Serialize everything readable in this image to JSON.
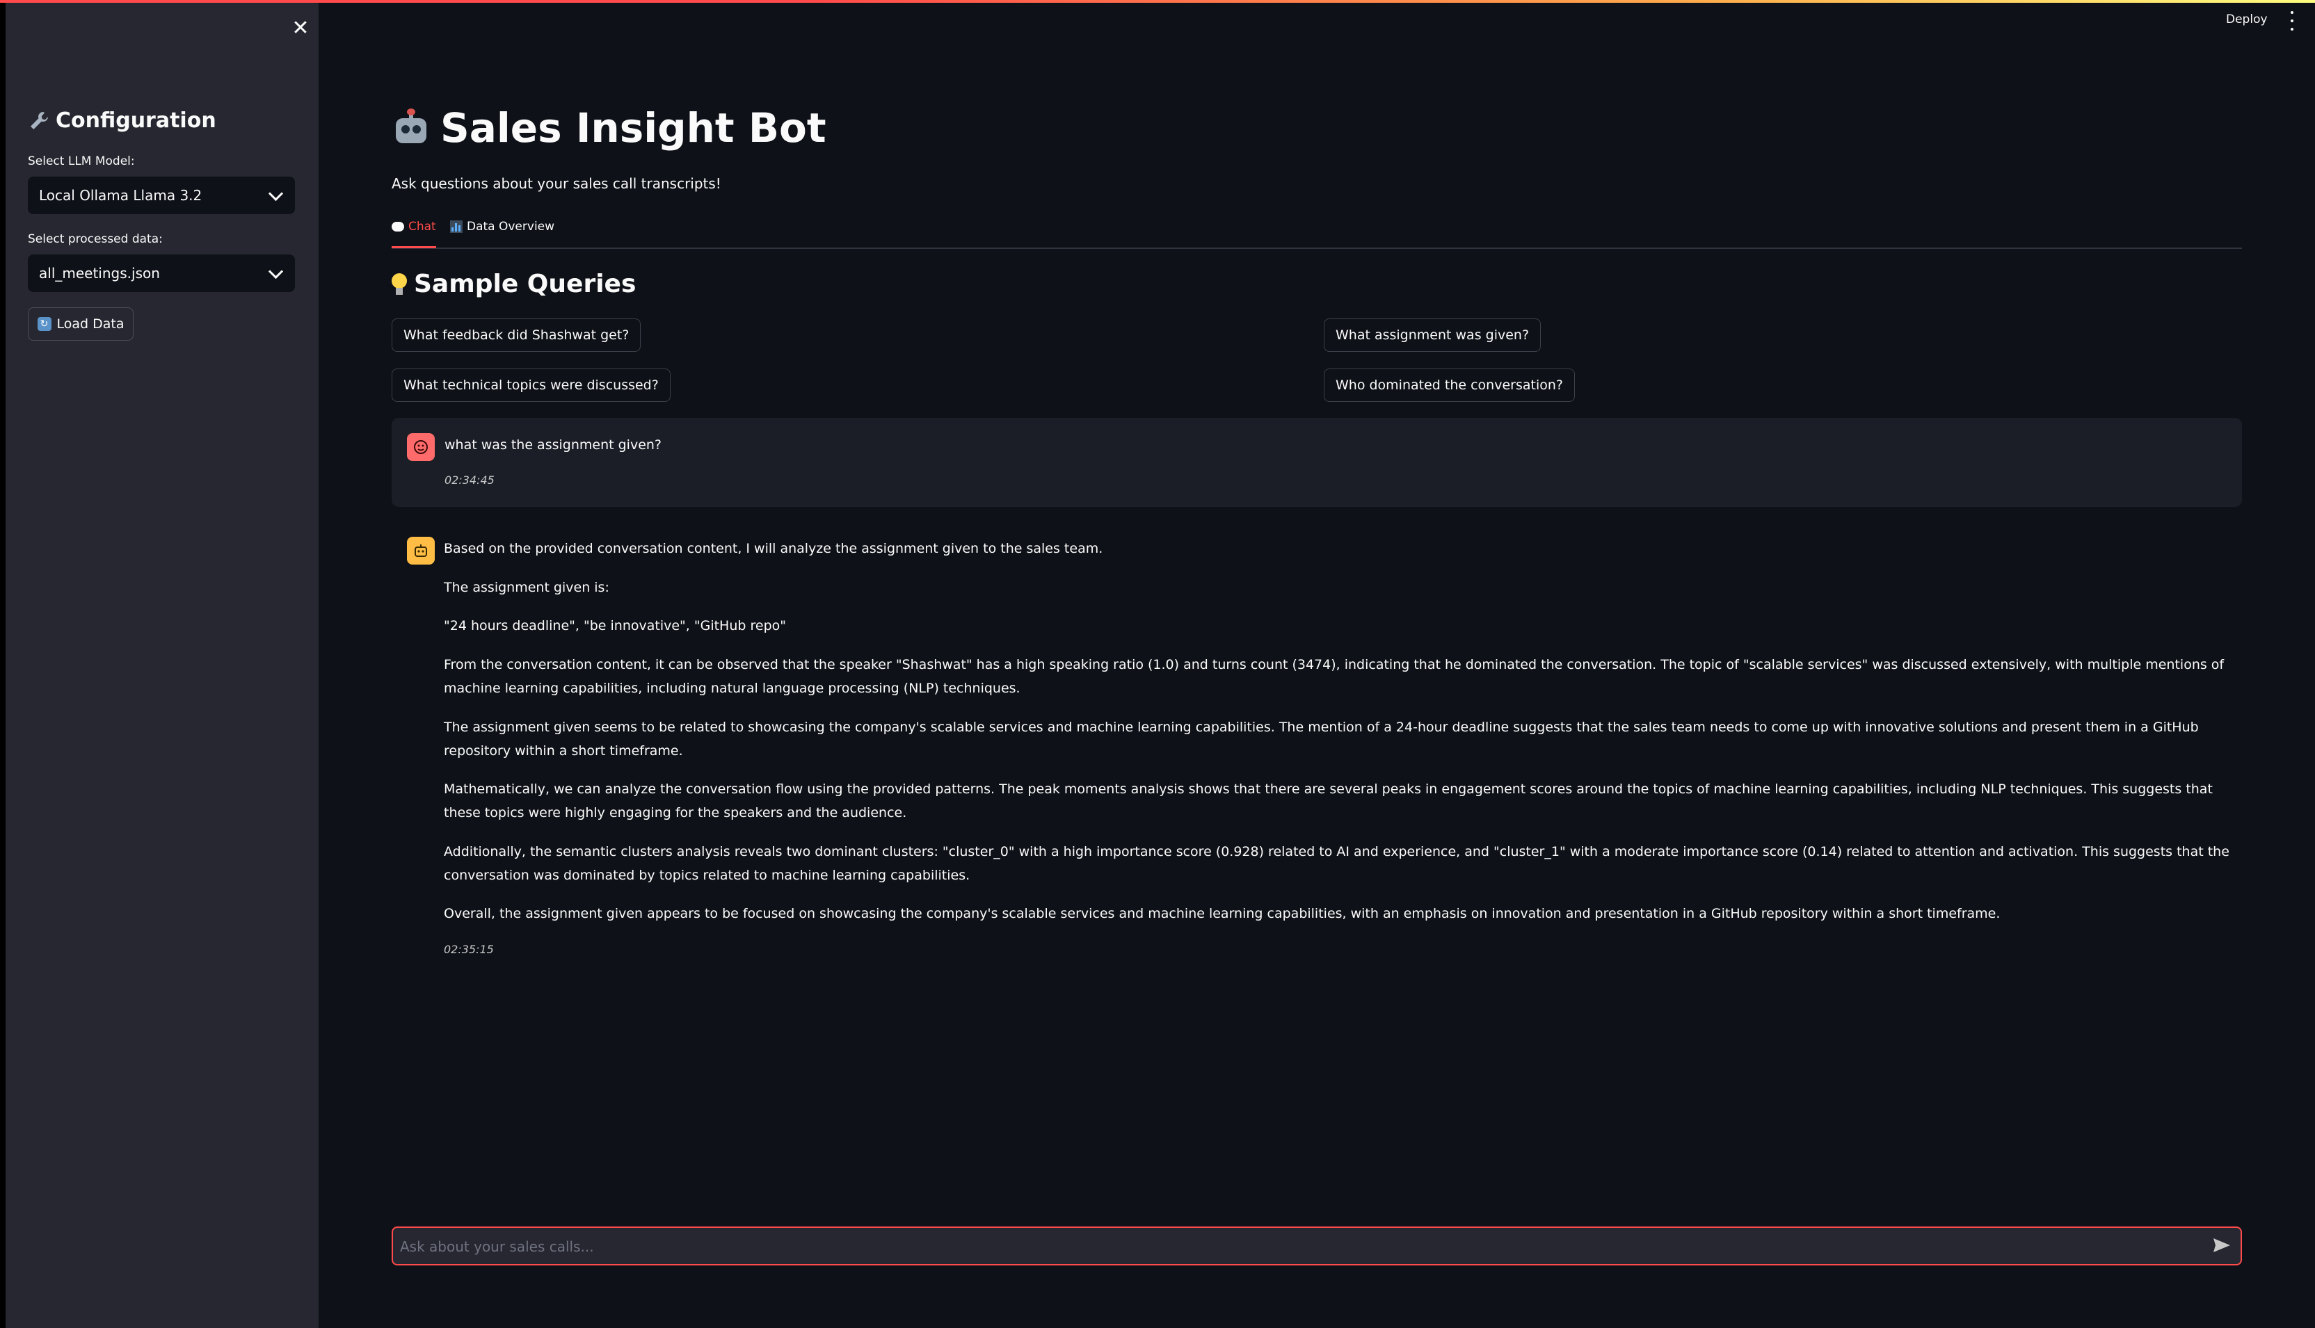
{
  "sidebar": {
    "title": "Configuration",
    "model_label": "Select LLM Model:",
    "model_value": "Local Ollama Llama 3.2",
    "data_label": "Select processed data:",
    "data_value": "all_meetings.json",
    "load_button": "Load Data"
  },
  "header": {
    "deploy": "Deploy"
  },
  "main": {
    "title": "Sales Insight Bot",
    "subtitle": "Ask questions about your sales call transcripts!",
    "tabs": [
      {
        "label": "Chat"
      },
      {
        "label": "Data Overview"
      }
    ],
    "sample_title": "Sample Queries",
    "queries": [
      "What feedback did Shashwat get?",
      "What assignment was given?",
      "What technical topics were discussed?",
      "Who dominated the conversation?"
    ]
  },
  "chat": {
    "user_message": {
      "text": "what was the assignment given?",
      "time": "02:34:45"
    },
    "bot_message": {
      "paragraphs": [
        "Based on the provided conversation content, I will analyze the assignment given to the sales team.",
        "The assignment given is:",
        "\"24 hours deadline\", \"be innovative\", \"GitHub repo\"",
        "From the conversation content, it can be observed that the speaker \"Shashwat\" has a high speaking ratio (1.0) and turns count (3474), indicating that he dominated the conversation. The topic of \"scalable services\" was discussed extensively, with multiple mentions of machine learning capabilities, including natural language processing (NLP) techniques.",
        "The assignment given seems to be related to showcasing the company's scalable services and machine learning capabilities. The mention of a 24-hour deadline suggests that the sales team needs to come up with innovative solutions and present them in a GitHub repository within a short timeframe.",
        "Mathematically, we can analyze the conversation flow using the provided patterns. The peak moments analysis shows that there are several peaks in engagement scores around the topics of machine learning capabilities, including NLP techniques. This suggests that these topics were highly engaging for the speakers and the audience.",
        "Additionally, the semantic clusters analysis reveals two dominant clusters: \"cluster_0\" with a high importance score (0.928) related to AI and experience, and \"cluster_1\" with a moderate importance score (0.14) related to attention and activation. This suggests that the conversation was dominated by topics related to machine learning capabilities.",
        "Overall, the assignment given appears to be focused on showcasing the company's scalable services and machine learning capabilities, with an emphasis on innovation and presentation in a GitHub repository within a short timeframe."
      ],
      "time": "02:35:15"
    },
    "input_placeholder": "Ask about your sales calls..."
  },
  "colors": {
    "accent": "#ff4b4b",
    "background": "#0e1117",
    "sidebar": "#262730"
  }
}
